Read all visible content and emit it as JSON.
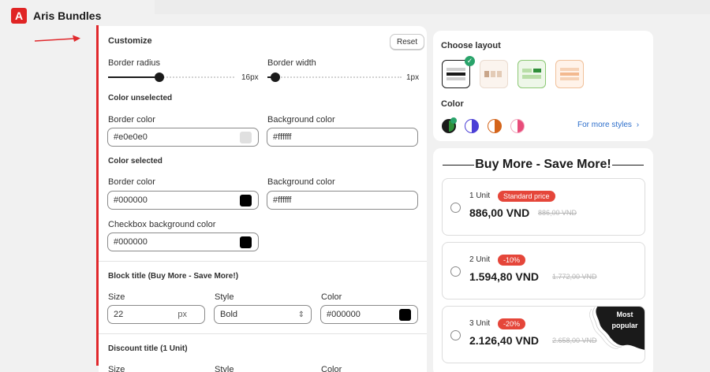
{
  "app": {
    "title": "Aris Bundles",
    "logo_letter": "A"
  },
  "customize": {
    "title": "Customize",
    "reset_label": "Reset",
    "border_radius": {
      "label": "Border radius",
      "value": 16,
      "max": 40,
      "display": "16px"
    },
    "border_width": {
      "label": "Border width",
      "value": 1,
      "max": 40,
      "display": "1px"
    },
    "color_unselected": {
      "title": "Color unselected",
      "border_label": "Border color",
      "border_value": "#e0e0e0",
      "bg_label": "Background color",
      "bg_value": "#ffffff"
    },
    "color_selected": {
      "title": "Color selected",
      "border_label": "Border color",
      "border_value": "#000000",
      "bg_label": "Background color",
      "bg_value": "#ffffff",
      "checkbox_label": "Checkbox background color",
      "checkbox_value": "#000000"
    },
    "block_title": {
      "title": "Block title (Buy More - Save More!)",
      "size_label": "Size",
      "size_value": "22",
      "size_unit": "px",
      "style_label": "Style",
      "style_value": "Bold",
      "color_label": "Color",
      "color_value": "#000000"
    },
    "discount_title": {
      "title": "Discount title (1 Unit)",
      "size_label": "Size",
      "style_label": "Style",
      "color_label": "Color"
    }
  },
  "layout": {
    "title": "Choose layout",
    "color_title": "Color",
    "more_styles": "For more styles",
    "selected_layout": 1,
    "options": [
      "layout-1",
      "layout-2",
      "layout-3",
      "layout-4"
    ],
    "color_options": [
      "#1a1a1a",
      "#4b3fd6",
      "#d4641a",
      "#e84c7a"
    ],
    "selected_color": 1
  },
  "preview": {
    "title": "Buy More - Save More!",
    "offers": [
      {
        "unit": "1 Unit",
        "badge": "Standard price",
        "price": "886,00 VND",
        "compare": "886,00 VND"
      },
      {
        "unit": "2 Unit",
        "badge": "-10%",
        "price": "1.594,80 VND",
        "compare": "1.772,00 VND"
      },
      {
        "unit": "3 Unit",
        "badge": "-20%",
        "price": "2.126,40 VND",
        "compare": "2.658,00 VND",
        "tag": "Most popular"
      }
    ]
  },
  "colors": {
    "accent_red": "#e0282c",
    "badge_red": "#e5463a",
    "link_blue": "#2c6ecb",
    "check_green": "#29a36a"
  }
}
